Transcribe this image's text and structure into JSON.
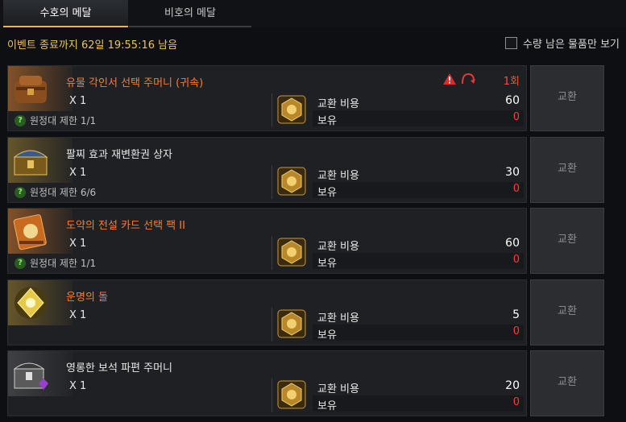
{
  "tabs": [
    "수호의 메달",
    "비호의 메달"
  ],
  "event_timer": "이벤트 종료까지 62일 19:55:16 남음",
  "filter_label": "수량 남은 물품만 보기",
  "cost_label": "교환 비용",
  "owned_label": "보유",
  "exchange_label": "교환",
  "colors": {
    "accent": "#f0c35a",
    "name_orange": "#ff7a2a",
    "red": "#ff3b2e"
  },
  "items": [
    {
      "name": "유물 각인서 선택 주머니 (귀속)",
      "qty": "X 1",
      "limit": "원정대 제한 1/1",
      "cost": "60",
      "owned": "0",
      "count": "1회",
      "icon": "leather-pouch-icon"
    },
    {
      "name": "팔찌 효과 재변환권 상자",
      "qty": "X 1",
      "limit": "원정대 제한 6/6",
      "cost": "30",
      "owned": "0",
      "icon": "gold-chest-icon"
    },
    {
      "name": "도약의 전설 카드 선택 팩 II",
      "qty": "X 1",
      "limit": "원정대 제한 1/1",
      "cost": "60",
      "owned": "0",
      "icon": "card-book-icon"
    },
    {
      "name": "운명의 돌",
      "qty": "X 1",
      "cost": "5",
      "owned": "0",
      "icon": "destiny-stone-icon"
    },
    {
      "name": "영롱한 보석 파편 주머니",
      "qty": "X 1",
      "cost": "20",
      "owned": "0",
      "icon": "jewel-chest-icon"
    }
  ]
}
